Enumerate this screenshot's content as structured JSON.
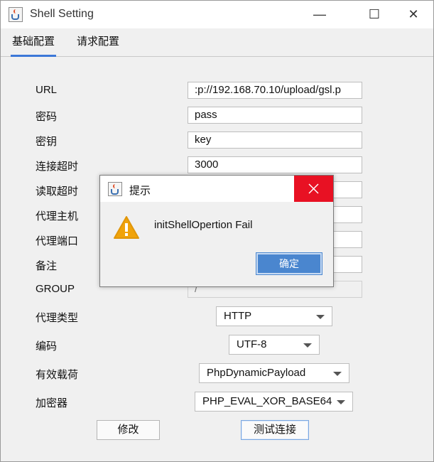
{
  "window": {
    "title": "Shell Setting",
    "minimize_glyph": "—",
    "maximize_glyph": "☐",
    "close_glyph": "✕"
  },
  "tabs": [
    {
      "label": "基础配置",
      "active": true
    },
    {
      "label": "请求配置",
      "active": false
    }
  ],
  "form": {
    "url_label": "URL",
    "url_value": ":p://192.168.70.10/upload/gsl.p",
    "password_label": "密码",
    "password_value": "pass",
    "key_label": "密钥",
    "key_value": "key",
    "connect_timeout_label": "连接超时",
    "connect_timeout_value": "3000",
    "read_timeout_label": "读取超时",
    "proxy_host_label": "代理主机",
    "proxy_port_label": "代理端口",
    "remark_label": "备注",
    "group_label": "GROUP",
    "group_value": "/",
    "proxy_type_label": "代理类型",
    "proxy_type_value": "HTTP",
    "encoding_label": "编码",
    "encoding_value": "UTF-8",
    "payload_label": "有效载荷",
    "payload_value": "PhpDynamicPayload",
    "cryption_label": "加密器",
    "cryption_value": "PHP_EVAL_XOR_BASE64",
    "modify_button": "修改",
    "test_button": "测试连接"
  },
  "dialog": {
    "title": "提示",
    "message": "initShellOpertion Fail",
    "ok_button": "确定",
    "close_color": "#e81123",
    "warning_color": "#f0a30a"
  },
  "icons": {
    "app": "java-cup-icon",
    "warning": "warning-triangle-icon",
    "close": "close-icon"
  }
}
